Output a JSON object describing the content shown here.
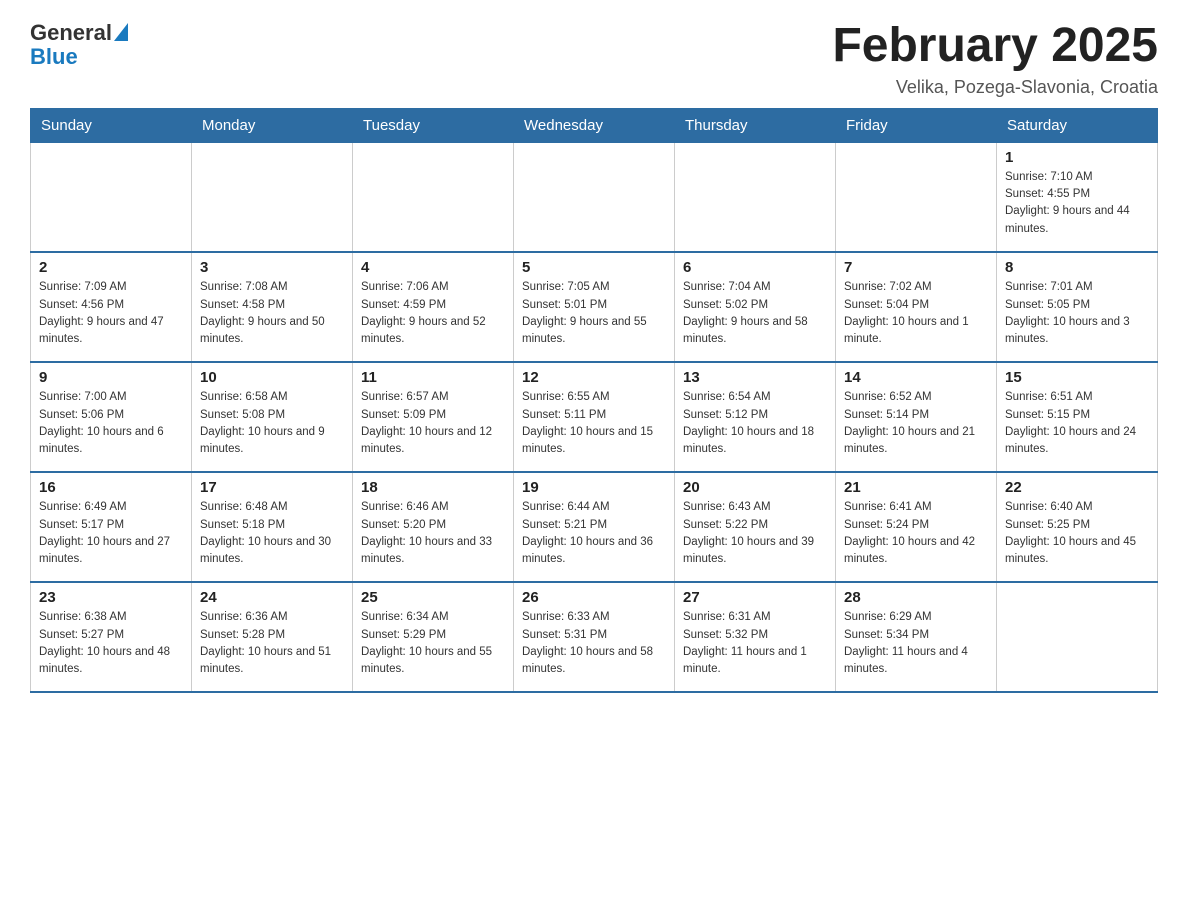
{
  "logo": {
    "general": "General",
    "blue": "Blue"
  },
  "title": "February 2025",
  "location": "Velika, Pozega-Slavonia, Croatia",
  "weekdays": [
    "Sunday",
    "Monday",
    "Tuesday",
    "Wednesday",
    "Thursday",
    "Friday",
    "Saturday"
  ],
  "weeks": [
    [
      {
        "day": "",
        "info": ""
      },
      {
        "day": "",
        "info": ""
      },
      {
        "day": "",
        "info": ""
      },
      {
        "day": "",
        "info": ""
      },
      {
        "day": "",
        "info": ""
      },
      {
        "day": "",
        "info": ""
      },
      {
        "day": "1",
        "info": "Sunrise: 7:10 AM\nSunset: 4:55 PM\nDaylight: 9 hours and 44 minutes."
      }
    ],
    [
      {
        "day": "2",
        "info": "Sunrise: 7:09 AM\nSunset: 4:56 PM\nDaylight: 9 hours and 47 minutes."
      },
      {
        "day": "3",
        "info": "Sunrise: 7:08 AM\nSunset: 4:58 PM\nDaylight: 9 hours and 50 minutes."
      },
      {
        "day": "4",
        "info": "Sunrise: 7:06 AM\nSunset: 4:59 PM\nDaylight: 9 hours and 52 minutes."
      },
      {
        "day": "5",
        "info": "Sunrise: 7:05 AM\nSunset: 5:01 PM\nDaylight: 9 hours and 55 minutes."
      },
      {
        "day": "6",
        "info": "Sunrise: 7:04 AM\nSunset: 5:02 PM\nDaylight: 9 hours and 58 minutes."
      },
      {
        "day": "7",
        "info": "Sunrise: 7:02 AM\nSunset: 5:04 PM\nDaylight: 10 hours and 1 minute."
      },
      {
        "day": "8",
        "info": "Sunrise: 7:01 AM\nSunset: 5:05 PM\nDaylight: 10 hours and 3 minutes."
      }
    ],
    [
      {
        "day": "9",
        "info": "Sunrise: 7:00 AM\nSunset: 5:06 PM\nDaylight: 10 hours and 6 minutes."
      },
      {
        "day": "10",
        "info": "Sunrise: 6:58 AM\nSunset: 5:08 PM\nDaylight: 10 hours and 9 minutes."
      },
      {
        "day": "11",
        "info": "Sunrise: 6:57 AM\nSunset: 5:09 PM\nDaylight: 10 hours and 12 minutes."
      },
      {
        "day": "12",
        "info": "Sunrise: 6:55 AM\nSunset: 5:11 PM\nDaylight: 10 hours and 15 minutes."
      },
      {
        "day": "13",
        "info": "Sunrise: 6:54 AM\nSunset: 5:12 PM\nDaylight: 10 hours and 18 minutes."
      },
      {
        "day": "14",
        "info": "Sunrise: 6:52 AM\nSunset: 5:14 PM\nDaylight: 10 hours and 21 minutes."
      },
      {
        "day": "15",
        "info": "Sunrise: 6:51 AM\nSunset: 5:15 PM\nDaylight: 10 hours and 24 minutes."
      }
    ],
    [
      {
        "day": "16",
        "info": "Sunrise: 6:49 AM\nSunset: 5:17 PM\nDaylight: 10 hours and 27 minutes."
      },
      {
        "day": "17",
        "info": "Sunrise: 6:48 AM\nSunset: 5:18 PM\nDaylight: 10 hours and 30 minutes."
      },
      {
        "day": "18",
        "info": "Sunrise: 6:46 AM\nSunset: 5:20 PM\nDaylight: 10 hours and 33 minutes."
      },
      {
        "day": "19",
        "info": "Sunrise: 6:44 AM\nSunset: 5:21 PM\nDaylight: 10 hours and 36 minutes."
      },
      {
        "day": "20",
        "info": "Sunrise: 6:43 AM\nSunset: 5:22 PM\nDaylight: 10 hours and 39 minutes."
      },
      {
        "day": "21",
        "info": "Sunrise: 6:41 AM\nSunset: 5:24 PM\nDaylight: 10 hours and 42 minutes."
      },
      {
        "day": "22",
        "info": "Sunrise: 6:40 AM\nSunset: 5:25 PM\nDaylight: 10 hours and 45 minutes."
      }
    ],
    [
      {
        "day": "23",
        "info": "Sunrise: 6:38 AM\nSunset: 5:27 PM\nDaylight: 10 hours and 48 minutes."
      },
      {
        "day": "24",
        "info": "Sunrise: 6:36 AM\nSunset: 5:28 PM\nDaylight: 10 hours and 51 minutes."
      },
      {
        "day": "25",
        "info": "Sunrise: 6:34 AM\nSunset: 5:29 PM\nDaylight: 10 hours and 55 minutes."
      },
      {
        "day": "26",
        "info": "Sunrise: 6:33 AM\nSunset: 5:31 PM\nDaylight: 10 hours and 58 minutes."
      },
      {
        "day": "27",
        "info": "Sunrise: 6:31 AM\nSunset: 5:32 PM\nDaylight: 11 hours and 1 minute."
      },
      {
        "day": "28",
        "info": "Sunrise: 6:29 AM\nSunset: 5:34 PM\nDaylight: 11 hours and 4 minutes."
      },
      {
        "day": "",
        "info": ""
      }
    ]
  ]
}
